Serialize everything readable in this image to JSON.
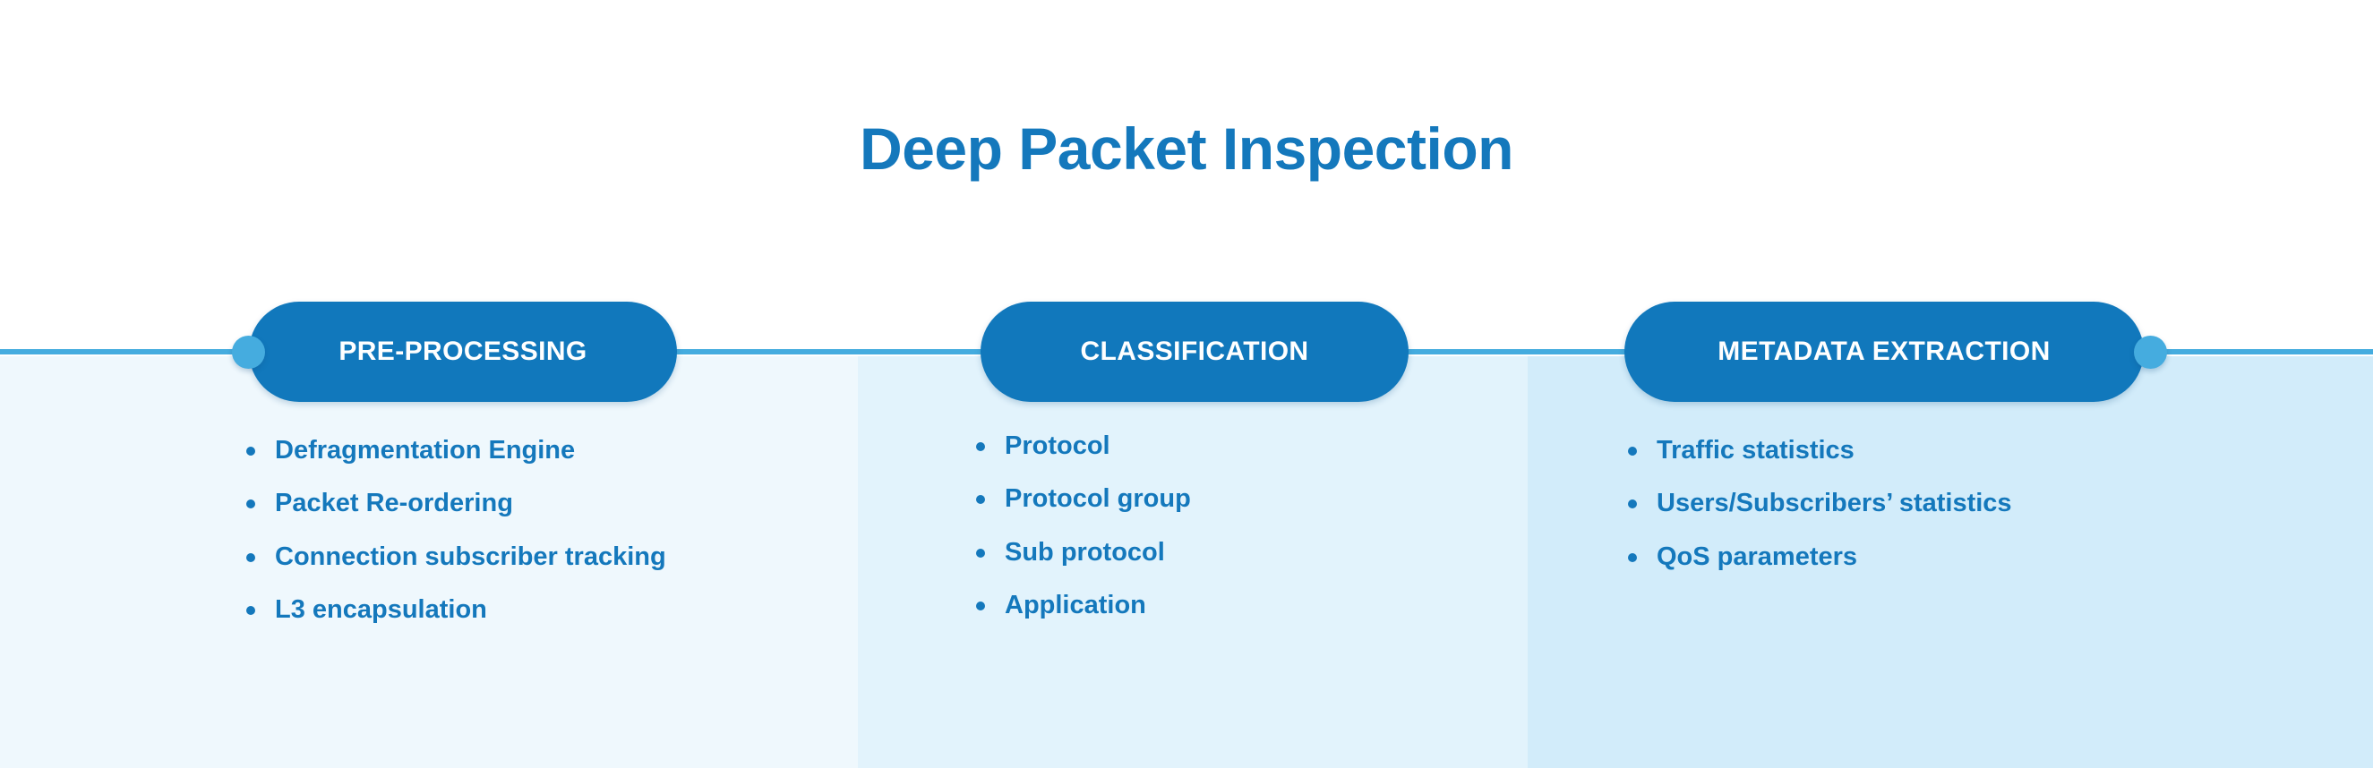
{
  "title": "Deep Packet Inspection",
  "colors": {
    "brand_blue": "#1478BC",
    "pill_blue": "#1178BC",
    "accent_light_blue": "#45ACDF",
    "panel_1_bg": "#EFF8FD",
    "panel_2_bg": "#E2F3FC",
    "panel_3_bg": "#D2ECFA",
    "page_bg": "#FFFFFF"
  },
  "stages": [
    {
      "label": "PRE-PROCESSING",
      "items": [
        "Defragmentation Engine",
        "Packet Re-ordering",
        "Connection subscriber tracking",
        "L3 encapsulation"
      ]
    },
    {
      "label": "CLASSIFICATION",
      "items": [
        "Protocol",
        "Protocol group",
        "Sub protocol",
        "Application"
      ]
    },
    {
      "label": "METADATA EXTRACTION",
      "items": [
        "Traffic statistics",
        "Users/Subscribers’ statistics",
        "QoS parameters"
      ]
    }
  ]
}
